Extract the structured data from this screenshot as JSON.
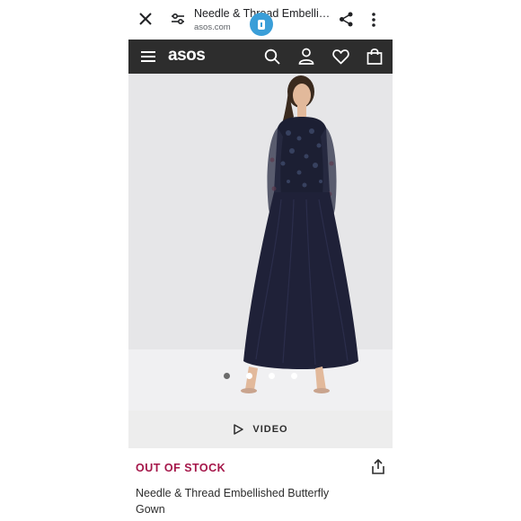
{
  "browser": {
    "page_title": "Needle & Thread Embellis...",
    "url": "asos.com",
    "icons": [
      "close-icon",
      "tune-icon",
      "shield-badge-icon",
      "share-icon",
      "more-vert-icon"
    ]
  },
  "site_header": {
    "logo": "asos",
    "icons": [
      "menu-icon",
      "search-icon",
      "account-icon",
      "heart-icon",
      "bag-icon"
    ]
  },
  "gallery": {
    "slide_count": 4,
    "active_slide": 1
  },
  "video": {
    "label": "VIDEO"
  },
  "product": {
    "stock_status": "OUT OF STOCK",
    "name": "Needle & Thread Embellished Butterfly Gown"
  },
  "colors": {
    "header_bg": "#2d2d2d",
    "stock_status": "#a5174a",
    "badge": "#3a9ed8",
    "image_bg": "#e6e6e8",
    "gown": "#1f2138"
  }
}
